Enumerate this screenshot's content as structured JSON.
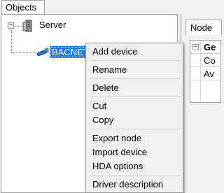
{
  "objects_tab": {
    "label": "Objects"
  },
  "tree": {
    "collapse_glyph": "−",
    "server": {
      "label": "Server",
      "icon": "server-icon"
    },
    "bacnetip": {
      "label": "BACNETIP",
      "icon": "network-plug-icon",
      "selected": true
    }
  },
  "right_panel": {
    "tab_label": "Node",
    "properties": {
      "collapse_glyph": "−",
      "group_header": "Ge",
      "rows": [
        {
          "label": "Co"
        },
        {
          "label": "Av"
        }
      ]
    }
  },
  "context_menu": {
    "items": [
      {
        "label": "Add device"
      },
      {
        "label": "Rename"
      },
      {
        "label": "Delete"
      },
      {
        "label": "Cut"
      },
      {
        "label": "Copy"
      },
      {
        "label": "Export node"
      },
      {
        "label": "Import device"
      },
      {
        "label": "HDA options"
      },
      {
        "label": "Driver description"
      }
    ]
  },
  "colors": {
    "selection": "#1c7ad4",
    "menu_background": "#f0f0f0",
    "panel_border": "#a0a0a0"
  }
}
